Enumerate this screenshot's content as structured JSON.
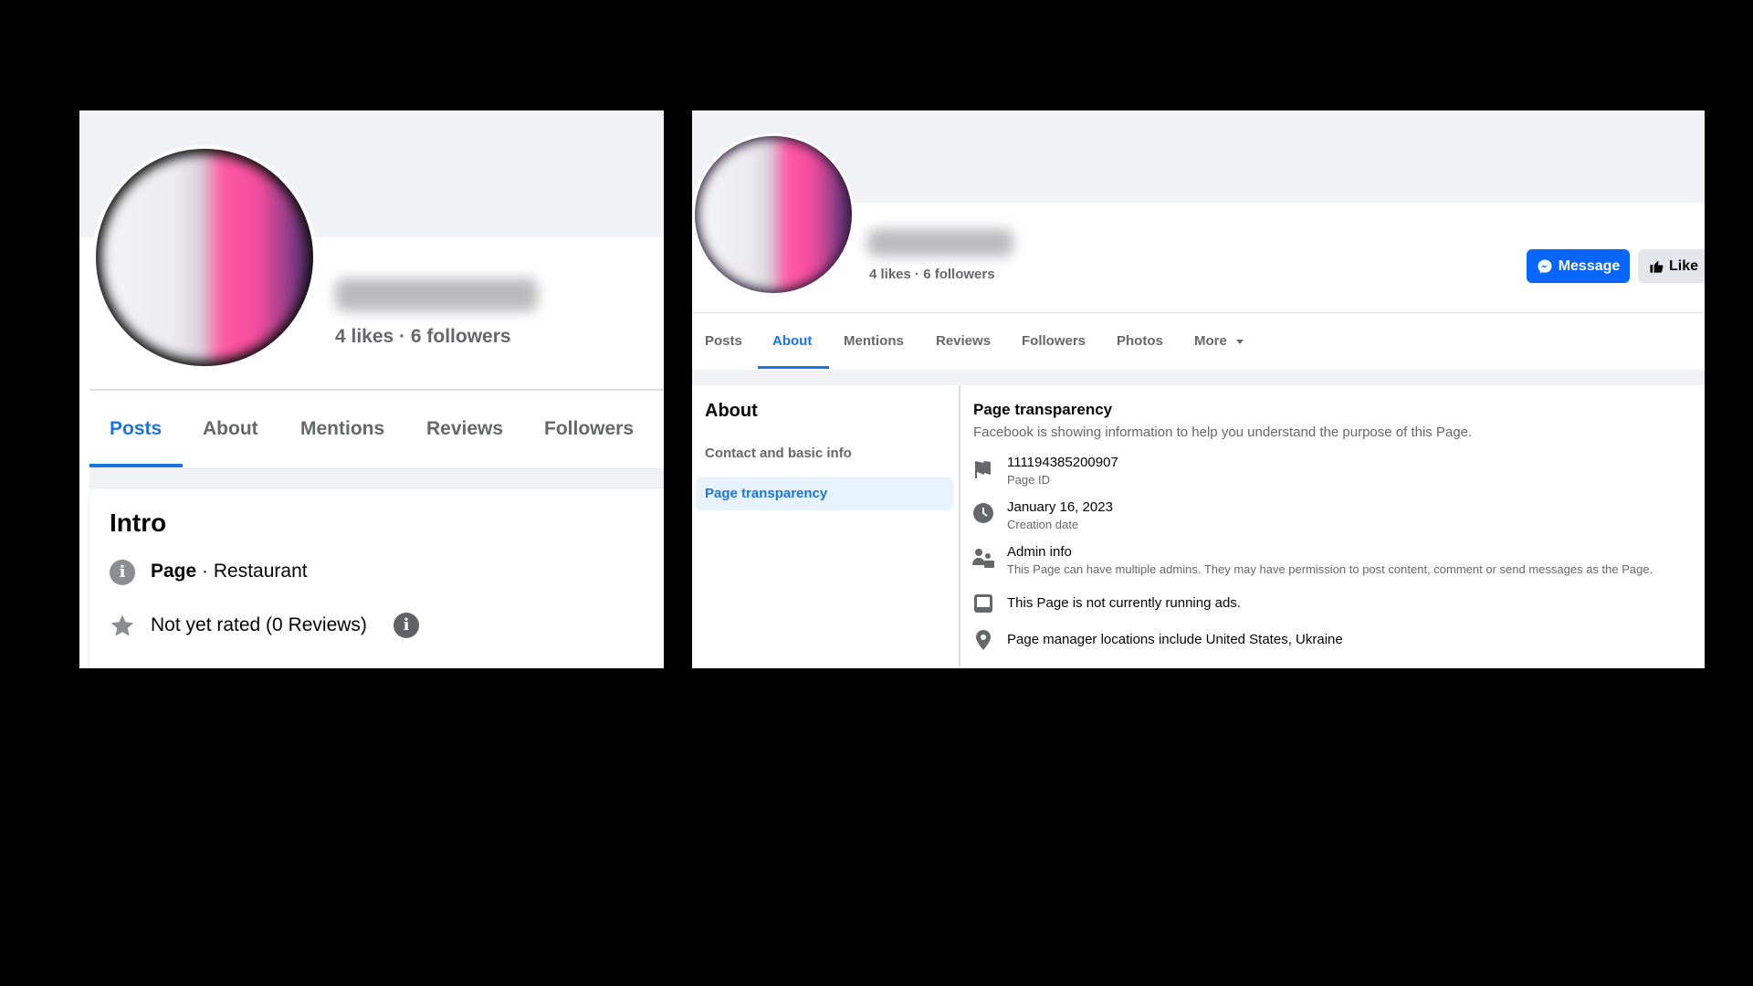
{
  "left_panel": {
    "stats": "4 likes · 6 followers",
    "tabs": [
      {
        "label": "Posts",
        "active": true
      },
      {
        "label": "About",
        "active": false
      },
      {
        "label": "Mentions",
        "active": false
      },
      {
        "label": "Reviews",
        "active": false
      },
      {
        "label": "Followers",
        "active": false
      }
    ],
    "intro": {
      "title": "Intro",
      "page_label": "Page",
      "page_category": " · Restaurant",
      "rating": "Not yet rated (0 Reviews)"
    }
  },
  "right_panel": {
    "stats": "4 likes · 6 followers",
    "buttons": {
      "message": "Message",
      "like": "Like"
    },
    "tabs": [
      {
        "label": "Posts",
        "active": false
      },
      {
        "label": "About",
        "active": true
      },
      {
        "label": "Mentions",
        "active": false
      },
      {
        "label": "Reviews",
        "active": false
      },
      {
        "label": "Followers",
        "active": false
      },
      {
        "label": "Photos",
        "active": false
      },
      {
        "label": "More",
        "active": false
      }
    ],
    "about_sidebar": {
      "title": "About",
      "links": [
        {
          "label": "Contact and basic info",
          "selected": false
        },
        {
          "label": "Page transparency",
          "selected": true
        }
      ]
    },
    "page_transparency": {
      "title": "Page transparency",
      "subtitle": "Facebook is showing information to help you understand the purpose of this Page.",
      "items": [
        {
          "icon": "flag-icon",
          "primary": "111194385200907",
          "secondary": "Page ID"
        },
        {
          "icon": "clock-icon",
          "primary": "January 16, 2023",
          "secondary": "Creation date"
        },
        {
          "icon": "admin-icon",
          "primary": "Admin info",
          "secondary": "This Page can have multiple admins. They may have permission to post content, comment or send messages as the Page."
        },
        {
          "icon": "ads-icon",
          "primary": "This Page is not currently running ads.",
          "secondary": ""
        },
        {
          "icon": "location-pin-icon",
          "primary": "Page manager locations include United States, Ukraine",
          "secondary": ""
        }
      ]
    }
  },
  "colors": {
    "accent": "#1b74e4",
    "message_button": "#0866ff",
    "muted_text": "#65676b",
    "cover": "#f0f2f5"
  }
}
